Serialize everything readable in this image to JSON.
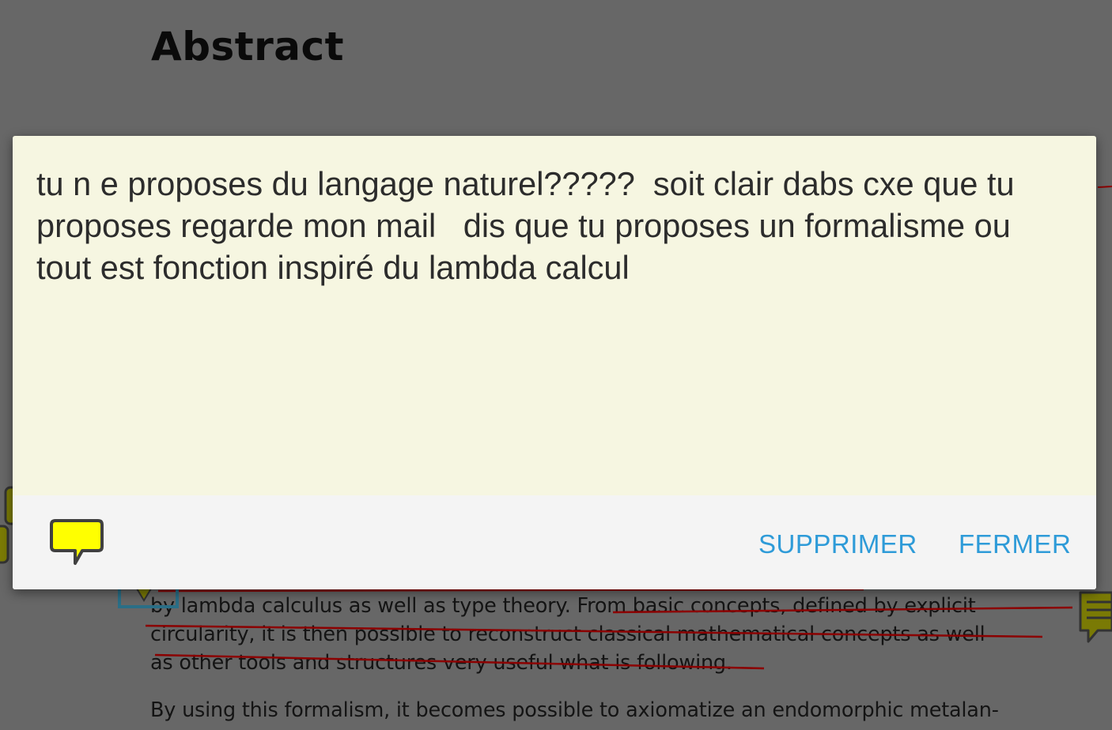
{
  "document": {
    "heading": "Abstract",
    "lines": [
      "by lambda calculus as well as type theory.  From basic concepts, defined by explicit",
      "circularity, it is then possible to reconstruct classical mathematical concepts as well",
      "as other tools and structures very useful what is following.",
      "By using this formalism, it becomes possible to axiomatize an endomorphic metalan-"
    ]
  },
  "dialog": {
    "note_text": "tu n e proposes du langage naturel?????  soit clair dabs cxe que tu proposes regarde mon mail   dis que tu proposes un formalisme ou tout est fonction inspiré du lambda calcul",
    "delete_label": "SUPPRIMER",
    "close_label": "FERMER",
    "note_icon": "comment-icon"
  },
  "colors": {
    "backdrop": "#676767",
    "dialog_bg": "#f6f6e1",
    "footer_bg": "#f4f4f4",
    "accent": "#2e9bd8",
    "note_yellow": "#ffff00",
    "strike_red": "#8b0000"
  }
}
